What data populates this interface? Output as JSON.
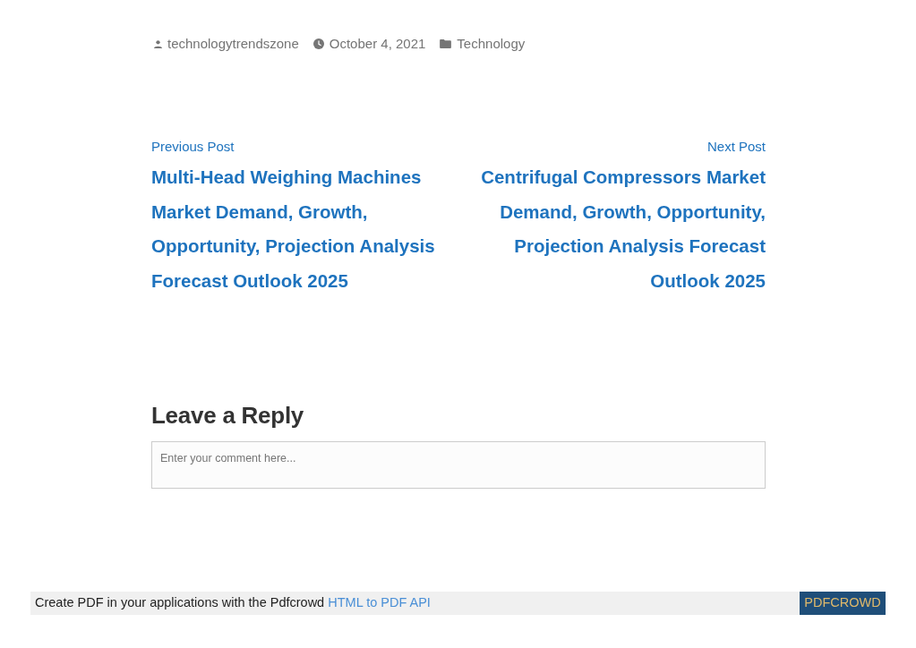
{
  "post_meta": [
    {
      "kind": "author",
      "text": "technologytrendszone"
    },
    {
      "kind": "date",
      "text": "October 4, 2021"
    },
    {
      "kind": "category",
      "text": "Technology"
    }
  ],
  "post_navigation": {
    "previous": {
      "label": "Previous Post",
      "title": "Multi-Head Weighing Machines Market Demand, Growth, Opportunity, Projection Analysis Forecast Outlook 2025"
    },
    "next": {
      "label": "Next Post",
      "title": "Centrifugal Compressors Market Demand, Growth, Opportunity, Projection Analysis Forecast Outlook 2025"
    }
  },
  "comments": {
    "heading": "Leave a Reply",
    "comment_field": {
      "placeholder": "Enter your comment here..."
    }
  },
  "pdf_footer": {
    "text": "Create PDF in your applications with the Pdfcrowd",
    "link": "HTML to PDF API",
    "button": "PDFCROWD"
  }
}
